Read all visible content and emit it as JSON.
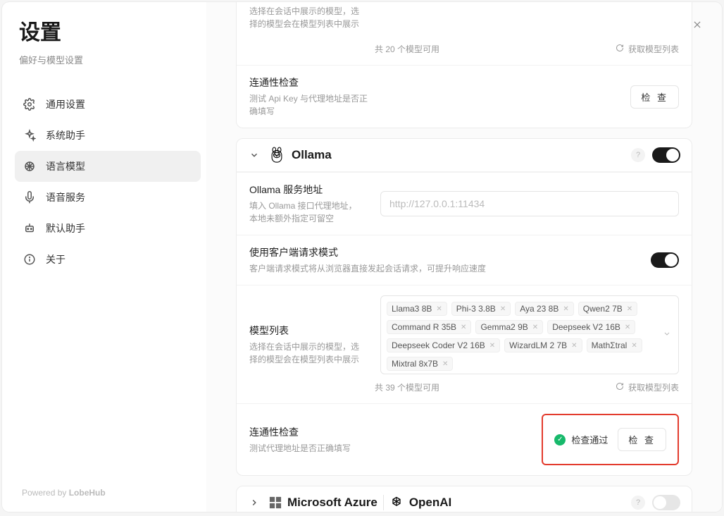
{
  "sidebar": {
    "title": "设置",
    "subtitle": "偏好与模型设置",
    "items": [
      {
        "label": "通用设置"
      },
      {
        "label": "系统助手"
      },
      {
        "label": "语言模型"
      },
      {
        "label": "语音服务"
      },
      {
        "label": "默认助手"
      },
      {
        "label": "关于"
      }
    ],
    "footer_prefix": "Powered by ",
    "footer_brand": "LobeHub"
  },
  "top_card": {
    "truncated_desc": "选择在会话中展示的模型，选\n择的模型会在模型列表中展示",
    "available_count": "共 20 个模型可用",
    "get_model_list": "获取模型列表",
    "connectivity_title": "连通性检查",
    "connectivity_desc": "测试 Api Key 与代理地址是否正确填写",
    "check_button": "检 查"
  },
  "ollama": {
    "name": "Ollama",
    "help": "?",
    "service_addr_title": "Ollama 服务地址",
    "service_addr_desc": "填入 Ollama 接口代理地址，\n本地未额外指定可留空",
    "service_addr_placeholder": "http://127.0.0.1:11434",
    "client_mode_title": "使用客户端请求模式",
    "client_mode_desc": "客户端请求模式将从浏览器直接发起会话请求，可提升响应速度",
    "model_list_title": "模型列表",
    "model_list_desc": "选择在会话中展示的模型，选\n择的模型会在模型列表中展示",
    "models": [
      "Llama3 8B",
      "Phi-3 3.8B",
      "Aya 23 8B",
      "Qwen2 7B",
      "Command R 35B",
      "Gemma2 9B",
      "Deepseek V2 16B",
      "Deepseek Coder V2 16B",
      "WizardLM 2 7B",
      "MathΣtral",
      "Mixtral 8x7B"
    ],
    "available_count": "共 39 个模型可用",
    "get_model_list": "获取模型列表",
    "connectivity_title": "连通性检查",
    "connectivity_desc": "测试代理地址是否正确填写",
    "check_pass": "检查通过",
    "check_button": "检 查"
  },
  "azure": {
    "label_ms": "Microsoft Azure",
    "label_openai": "OpenAI",
    "help": "?"
  }
}
